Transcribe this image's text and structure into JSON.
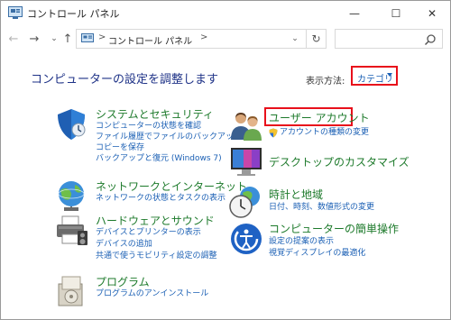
{
  "window": {
    "title": "コントロール パネル",
    "controls": {
      "minimize": "—",
      "maximize": "☐",
      "close": "✕"
    }
  },
  "nav": {
    "back": "←",
    "forward": "→",
    "recent": "⌄",
    "up": "↑",
    "address": {
      "separator": ">",
      "path": "コントロール パネル",
      "trailing_separator": ">",
      "dropdown": "⌄"
    },
    "refresh": "↻",
    "search_placeholder": ""
  },
  "header": {
    "title": "コンピューターの設定を調整します",
    "view_by_label": "表示方法:",
    "view_by_value": "カテゴリ"
  },
  "left_categories": [
    {
      "title": "システムとセキュリティ",
      "icon": "shield-icon",
      "links": [
        "コンピューターの状態を確認",
        "ファイル履歴でファイルのバックアップ",
        "コピーを保存",
        "バックアップと復元 (Windows 7)"
      ]
    },
    {
      "title": "ネットワークとインターネット",
      "icon": "network-globe-icon",
      "links": [
        "ネットワークの状態とタスクの表示"
      ]
    },
    {
      "title": "ハードウェアとサウンド",
      "icon": "printer-icon",
      "links": [
        "デバイスとプリンターの表示",
        "デバイスの追加",
        "共通で使うモビリティ設定の調整"
      ]
    },
    {
      "title": "プログラム",
      "icon": "programs-icon",
      "links": [
        "プログラムのアンインストール"
      ]
    }
  ],
  "right_categories": [
    {
      "title": "ユーザー アカウント",
      "icon": "users-icon",
      "links": [
        "アカウントの種類の変更"
      ]
    },
    {
      "title": "デスクトップのカスタマイズ",
      "icon": "display-icon",
      "links": []
    },
    {
      "title": "時計と地域",
      "icon": "clock-globe-icon",
      "links": [
        "日付、時刻、数値形式の変更"
      ]
    },
    {
      "title": "コンピューターの簡単操作",
      "icon": "ease-of-access-icon",
      "links": [
        "設定の提案の表示",
        "視覚ディスプレイの最適化"
      ]
    }
  ],
  "colors": {
    "category_title": "#1d7a2b",
    "link": "#1a5fb4",
    "heading": "#1e3287",
    "highlight": "#e8101b"
  }
}
